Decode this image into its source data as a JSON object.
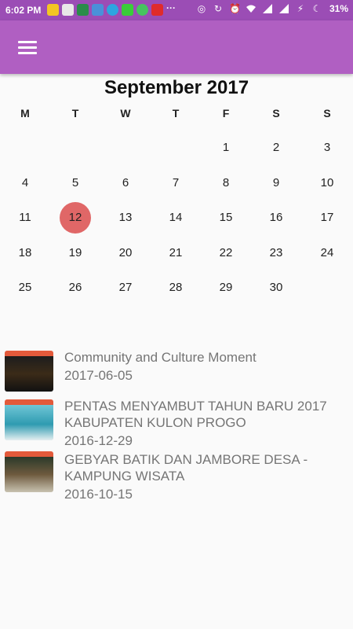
{
  "status_bar": {
    "time": "6:02 PM",
    "battery": "31%",
    "notification_icons": [
      "app-icon-1",
      "app-icon-2",
      "app-icon-3",
      "app-icon-4",
      "telegram-icon",
      "line-icon",
      "chat-icon",
      "youtube-icon",
      "more-icon"
    ],
    "system_icons": [
      "hotspot-icon",
      "sync-icon",
      "alarm-icon",
      "wifi-icon",
      "signal-icon",
      "signal-icon-2",
      "charging-icon",
      "do-not-disturb-icon"
    ]
  },
  "app_bar": {
    "menu_icon": "hamburger-menu-icon"
  },
  "calendar": {
    "title": "September 2017",
    "weekdays": [
      "M",
      "T",
      "W",
      "T",
      "F",
      "S",
      "S"
    ],
    "selected_day": "12",
    "weeks": [
      [
        "",
        "",
        "",
        "",
        "1",
        "2",
        "3"
      ],
      [
        "4",
        "5",
        "6",
        "7",
        "8",
        "9",
        "10"
      ],
      [
        "11",
        "12",
        "13",
        "14",
        "15",
        "16",
        "17"
      ],
      [
        "18",
        "19",
        "20",
        "21",
        "22",
        "23",
        "24"
      ],
      [
        "25",
        "26",
        "27",
        "28",
        "29",
        "30",
        ""
      ]
    ],
    "selected_color": "#e06767"
  },
  "events": [
    {
      "title": "Community and Culture Moment",
      "date": "2017-06-05"
    },
    {
      "title": "PENTAS MENYAMBUT TAHUN BARU 2017 KABUPATEN KULON PROGO",
      "date": "2016-12-29"
    },
    {
      "title": "GEBYAR BATIK DAN JAMBORE DESA - KAMPUNG WISATA",
      "date": "2016-10-15"
    }
  ],
  "colors": {
    "status_bar": "#9b4db5",
    "app_bar": "#b05fc2",
    "event_text": "#757575"
  }
}
